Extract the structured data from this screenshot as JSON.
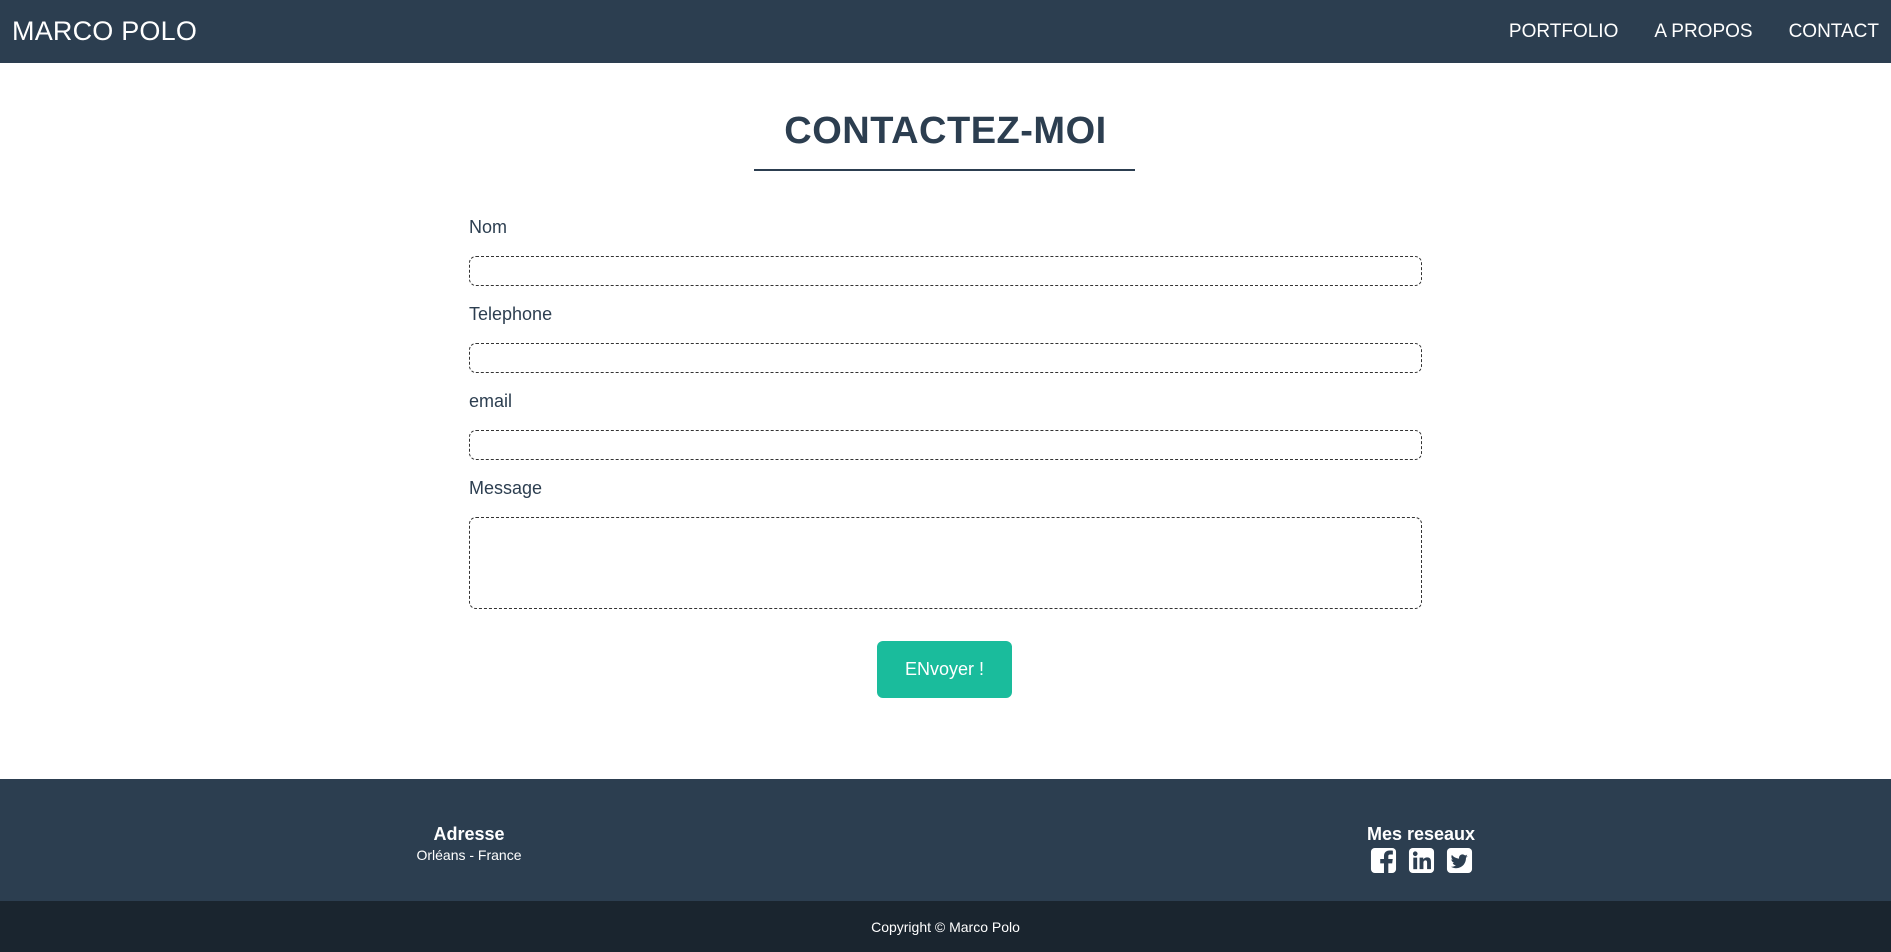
{
  "navbar": {
    "brand": "MARCO POLO",
    "links": [
      {
        "label": "PORTFOLIO"
      },
      {
        "label": "A PROPOS"
      },
      {
        "label": "CONTACT"
      }
    ]
  },
  "contact": {
    "title": "CONTACTEZ-MOI",
    "fields": [
      {
        "label": "Nom",
        "value": "",
        "placeholder": ""
      },
      {
        "label": "Telephone",
        "value": "",
        "placeholder": ""
      },
      {
        "label": "email",
        "value": "",
        "placeholder": ""
      },
      {
        "label": "Message",
        "value": "",
        "placeholder": ""
      }
    ],
    "submit_label": "ENvoyer !"
  },
  "footer": {
    "address_heading": "Adresse",
    "address_text": "Orléans - France",
    "social_heading": "Mes reseaux",
    "social_icons": [
      "facebook-icon",
      "linkedin-icon",
      "twitter-icon"
    ]
  },
  "copyright": "Copyright © Marco Polo",
  "colors": {
    "primary": "#2c3e50",
    "accent": "#1abc9c",
    "copyright_bg": "#1a252f"
  }
}
